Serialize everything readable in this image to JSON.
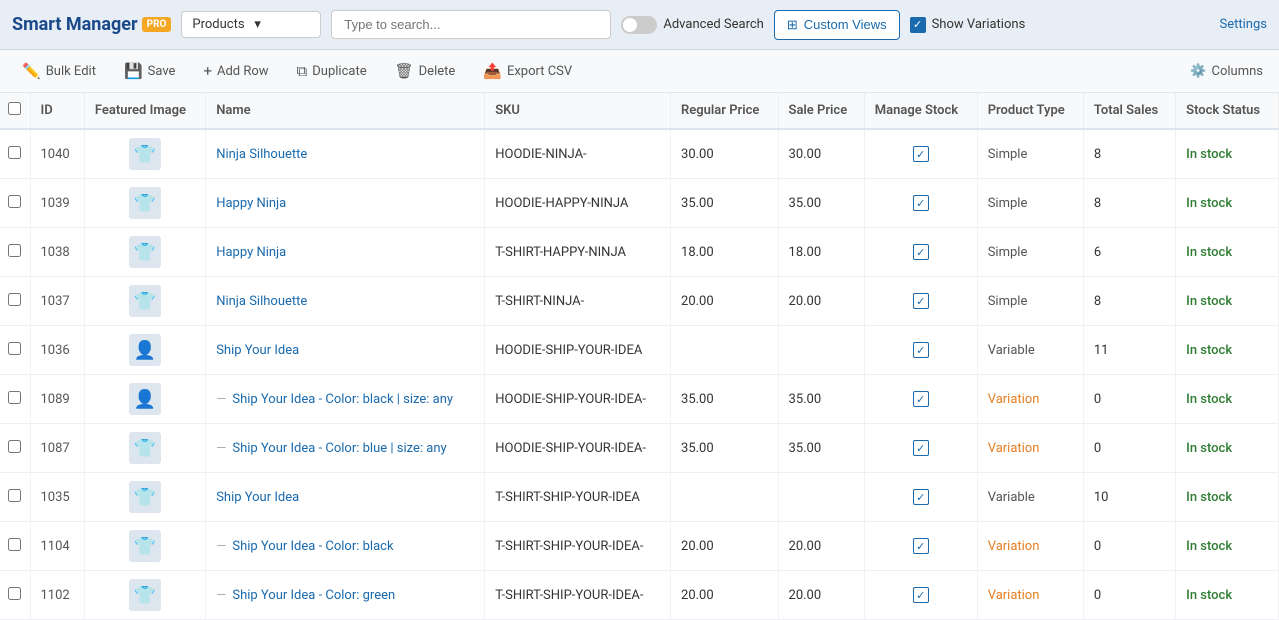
{
  "header": {
    "logo_text": "Smart Manager",
    "logo_pro": "PRO",
    "dropdown_value": "Products",
    "search_placeholder": "Type to search...",
    "advanced_search_label": "Advanced Search",
    "custom_views_label": "Custom Views",
    "show_variations_label": "Show Variations",
    "settings_label": "Settings"
  },
  "toolbar": {
    "bulk_edit_label": "Bulk Edit",
    "save_label": "Save",
    "add_row_label": "Add Row",
    "duplicate_label": "Duplicate",
    "delete_label": "Delete",
    "export_csv_label": "Export CSV",
    "columns_label": "Columns"
  },
  "table": {
    "columns": [
      "ID",
      "Featured Image",
      "Name",
      "SKU",
      "Regular Price",
      "Sale Price",
      "Manage Stock",
      "Product Type",
      "Total Sales",
      "Stock Status"
    ],
    "rows": [
      {
        "id": "1040",
        "img": "👕",
        "img_color": "#222",
        "name": "Ninja Silhouette",
        "sku": "HOODIE-NINJA-",
        "regular_price": "30.00",
        "sale_price": "30.00",
        "manage_stock": true,
        "product_type": "Simple",
        "total_sales": "8",
        "stock_status": "In stock",
        "is_variation": false
      },
      {
        "id": "1039",
        "img": "👕",
        "img_color": "#aaa",
        "name": "Happy Ninja",
        "sku": "HOODIE-HAPPY-NINJA",
        "regular_price": "35.00",
        "sale_price": "35.00",
        "manage_stock": true,
        "product_type": "Simple",
        "total_sales": "8",
        "stock_status": "In stock",
        "is_variation": false
      },
      {
        "id": "1038",
        "img": "👕",
        "img_color": "#bbb",
        "name": "Happy Ninja",
        "sku": "T-SHIRT-HAPPY-NINJA",
        "regular_price": "18.00",
        "sale_price": "18.00",
        "manage_stock": true,
        "product_type": "Simple",
        "total_sales": "6",
        "stock_status": "In stock",
        "is_variation": false
      },
      {
        "id": "1037",
        "img": "👕",
        "img_color": "#333",
        "name": "Ninja Silhouette",
        "sku": "T-SHIRT-NINJA-",
        "regular_price": "20.00",
        "sale_price": "20.00",
        "manage_stock": true,
        "product_type": "Simple",
        "total_sales": "8",
        "stock_status": "In stock",
        "is_variation": false
      },
      {
        "id": "1036",
        "img": "👤",
        "img_color": "#555",
        "name": "Ship Your Idea",
        "sku": "HOODIE-SHIP-YOUR-IDEA",
        "regular_price": "",
        "sale_price": "",
        "manage_stock": true,
        "product_type": "Variable",
        "total_sales": "11",
        "stock_status": "In stock",
        "is_variation": false
      },
      {
        "id": "1089",
        "img": "👤",
        "img_color": "#555",
        "name": "Ship Your Idea - Color: black | size: any",
        "sku": "HOODIE-SHIP-YOUR-IDEA-",
        "regular_price": "35.00",
        "sale_price": "35.00",
        "manage_stock": true,
        "product_type": "Variation",
        "total_sales": "0",
        "stock_status": "In stock",
        "is_variation": true
      },
      {
        "id": "1087",
        "img": "👕",
        "img_color": "#4a90d9",
        "name": "Ship Your Idea - Color: blue | size: any",
        "sku": "HOODIE-SHIP-YOUR-IDEA-",
        "regular_price": "35.00",
        "sale_price": "35.00",
        "manage_stock": true,
        "product_type": "Variation",
        "total_sales": "0",
        "stock_status": "In stock",
        "is_variation": true
      },
      {
        "id": "1035",
        "img": "👕",
        "img_color": "#333",
        "name": "Ship Your Idea",
        "sku": "T-SHIRT-SHIP-YOUR-IDEA",
        "regular_price": "",
        "sale_price": "",
        "manage_stock": true,
        "product_type": "Variable",
        "total_sales": "10",
        "stock_status": "In stock",
        "is_variation": false
      },
      {
        "id": "1104",
        "img": "👕",
        "img_color": "#333",
        "name": "Ship Your Idea - Color: black",
        "sku": "T-SHIRT-SHIP-YOUR-IDEA-",
        "regular_price": "20.00",
        "sale_price": "20.00",
        "manage_stock": true,
        "product_type": "Variation",
        "total_sales": "0",
        "stock_status": "In stock",
        "is_variation": true
      },
      {
        "id": "1102",
        "img": "👕",
        "img_color": "#5a7a3a",
        "name": "Ship Your Idea - Color: green",
        "sku": "T-SHIRT-SHIP-YOUR-IDEA-",
        "regular_price": "20.00",
        "sale_price": "20.00",
        "manage_stock": true,
        "product_type": "Variation",
        "total_sales": "0",
        "stock_status": "In stock",
        "is_variation": true
      }
    ]
  },
  "icons": {
    "save": "💾",
    "add_row": "➕",
    "duplicate": "🗐",
    "delete": "🗑",
    "export": "📤",
    "bulk_edit": "✏️",
    "columns": "⚙️",
    "custom_views": "⊞",
    "chevron_down": "▾",
    "check": "✓"
  }
}
